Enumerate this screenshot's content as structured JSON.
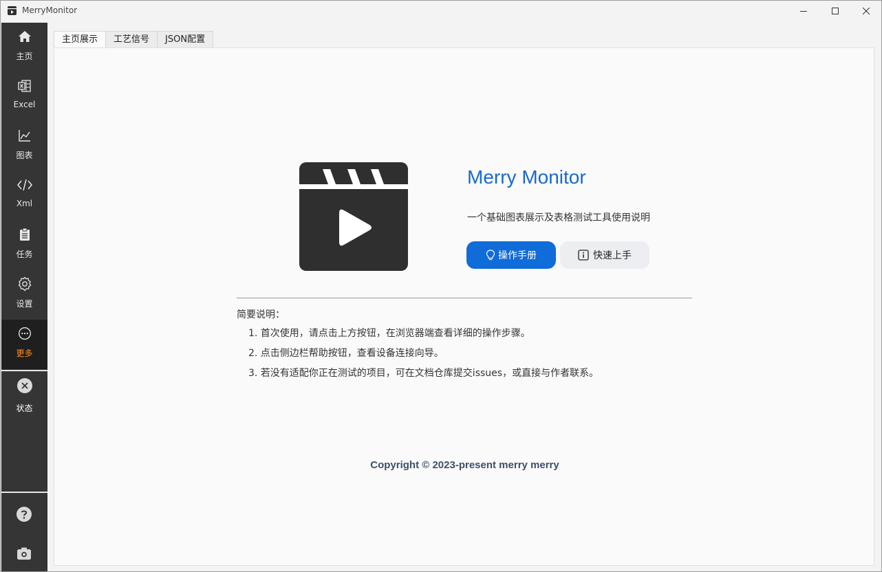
{
  "window": {
    "title": "MerryMonitor"
  },
  "sidebar": {
    "items": [
      {
        "label": "主页",
        "icon": "home-icon"
      },
      {
        "label": "Excel",
        "icon": "excel-icon"
      },
      {
        "label": "图表",
        "icon": "chart-icon"
      },
      {
        "label": "Xml",
        "icon": "code-icon"
      },
      {
        "label": "任务",
        "icon": "clipboard-icon"
      },
      {
        "label": "设置",
        "icon": "gear-icon"
      },
      {
        "label": "更多",
        "icon": "more-icon",
        "active": true
      }
    ],
    "status": {
      "label": "状态",
      "icon": "close-circle-icon"
    },
    "bottom": [
      {
        "icon": "help-icon"
      },
      {
        "icon": "camera-icon"
      }
    ]
  },
  "tabs": [
    {
      "label": "主页展示",
      "active": true
    },
    {
      "label": "工艺信号"
    },
    {
      "label": "JSON配置"
    }
  ],
  "main": {
    "app_name": "Merry Monitor",
    "description": "一个基础图表展示及表格测试工具使用说明",
    "primary_button": "操作手册",
    "secondary_button": "快速上手",
    "notes_title": "简要说明：",
    "notes": [
      "1. 首次使用，请点击上方按钮，在浏览器端查看详细的操作步骤。",
      "2. 点击侧边栏帮助按钮，查看设备连接向导。",
      "3. 若没有适配你正在测试的项目，可在文档仓库提交issues，或直接与作者联系。"
    ],
    "copyright": "Copyright © 2023-present merry merry"
  },
  "colors": {
    "accent": "#0f6cd8",
    "title_blue": "#1769d0",
    "sidebar_bg": "#353535",
    "active_label": "#ff8c1a"
  }
}
